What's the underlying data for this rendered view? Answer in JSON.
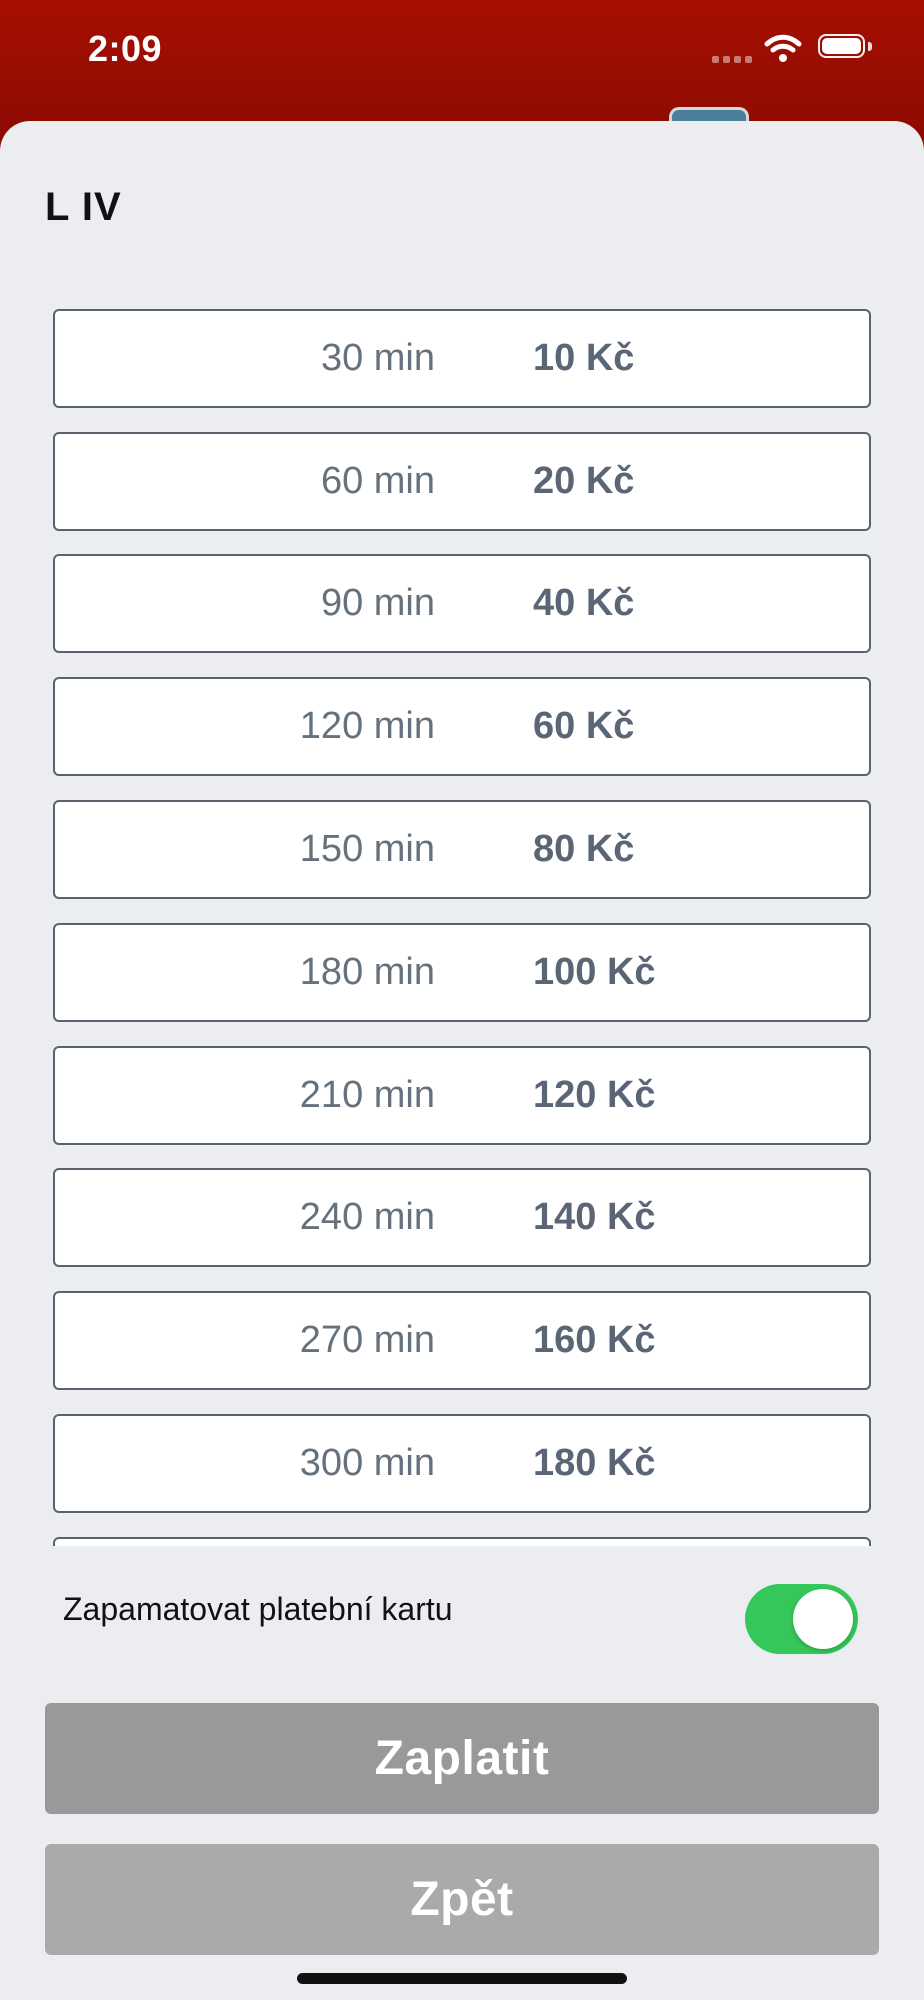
{
  "status_bar": {
    "time": "2:09",
    "icons": [
      "signal-icon",
      "wifi-icon",
      "battery-icon"
    ]
  },
  "sheet": {
    "title": "L IV"
  },
  "tariffs": [
    {
      "duration": "30 min",
      "price": "10 Kč"
    },
    {
      "duration": "60 min",
      "price": "20 Kč"
    },
    {
      "duration": "90 min",
      "price": "40 Kč"
    },
    {
      "duration": "120 min",
      "price": "60 Kč"
    },
    {
      "duration": "150 min",
      "price": "80 Kč"
    },
    {
      "duration": "180 min",
      "price": "100 Kč"
    },
    {
      "duration": "210 min",
      "price": "120 Kč"
    },
    {
      "duration": "240 min",
      "price": "140 Kč"
    },
    {
      "duration": "270 min",
      "price": "160 Kč"
    },
    {
      "duration": "300 min",
      "price": "180 Kč"
    },
    {
      "duration": "",
      "price": ""
    }
  ],
  "remember_card": {
    "label": "Zapamatovat platební kartu",
    "enabled": true
  },
  "buttons": {
    "pay": "Zaplatit",
    "back": "Zpět"
  },
  "colors": {
    "header": "#a70f02",
    "sheet_background": "#ebedf0",
    "border": "#59636f",
    "toggle_on": "#35c759",
    "pay_button": "#999999",
    "back_button": "#aaaaaa"
  }
}
